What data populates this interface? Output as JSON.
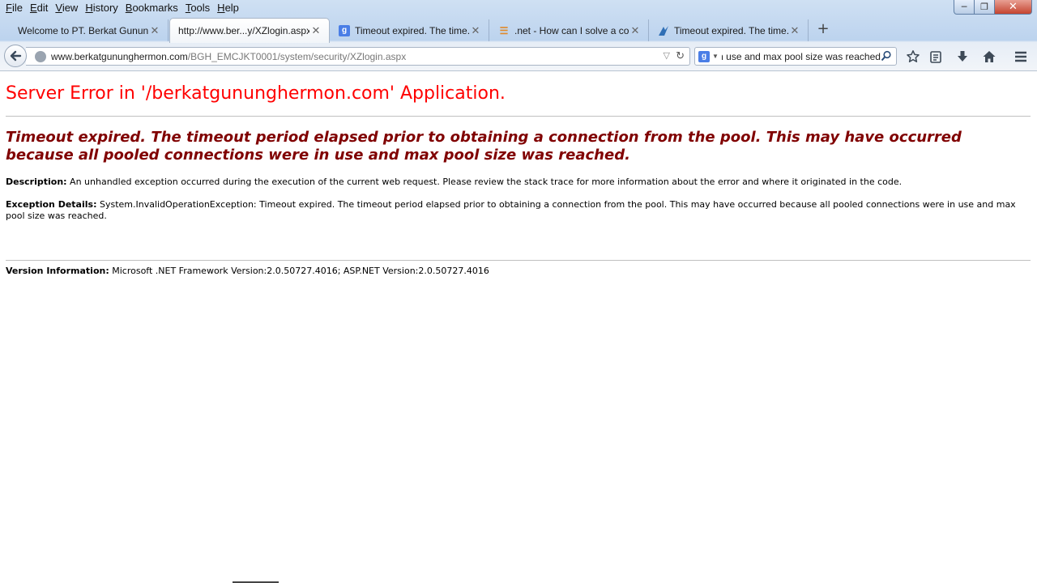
{
  "menu": [
    {
      "label_u": "F",
      "label_rest": "ile"
    },
    {
      "label_u": "E",
      "label_rest": "dit"
    },
    {
      "label_u": "V",
      "label_rest": "iew"
    },
    {
      "label_u": "H",
      "label_rest": "istory"
    },
    {
      "label_u": "B",
      "label_rest": "ookmarks"
    },
    {
      "label_u": "T",
      "label_rest": "ools"
    },
    {
      "label_u": "H",
      "label_rest": "elp"
    }
  ],
  "tabs": [
    {
      "label": "Welcome to PT. Berkat Gunun...",
      "active": false,
      "icon": "none"
    },
    {
      "label": "http://www.ber...y/XZlogin.aspx",
      "active": true,
      "icon": "none"
    },
    {
      "label": "Timeout expired. The time...",
      "active": false,
      "icon": "google-icon"
    },
    {
      "label": ".net - How can I solve a co...",
      "active": false,
      "icon": "stackoverflow-icon"
    },
    {
      "label": "Timeout expired. The time...",
      "active": false,
      "icon": "site-icon"
    }
  ],
  "url": {
    "host": "www.berkatgununghermon.com",
    "path": "/BGH_EMCJKT0001/system/security/XZlogin.aspx"
  },
  "search": {
    "engine_letter": "g",
    "value": "re in use and max pool size was reached."
  },
  "page": {
    "title": "Server Error in '/berkatgununghermon.com' Application.",
    "message": "Timeout expired.  The timeout period elapsed prior to obtaining a connection from the pool.  This may have occurred because all pooled connections were in use and max pool size was reached.",
    "description_label": "Description:",
    "description_text": " An unhandled exception occurred during the execution of the current web request. Please review the stack trace for more information about the error and where it originated in the code.",
    "exception_label": "Exception Details:",
    "exception_text": " System.InvalidOperationException: Timeout expired.  The timeout period elapsed prior to obtaining a connection from the pool.  This may have occurred because all pooled connections were in use and max pool size was reached.",
    "version_label": "Version Information:",
    "version_text": " Microsoft .NET Framework Version:2.0.50727.4016; ASP.NET Version:2.0.50727.4016"
  },
  "colors": {
    "title": "#ff0000",
    "message": "#800000"
  }
}
